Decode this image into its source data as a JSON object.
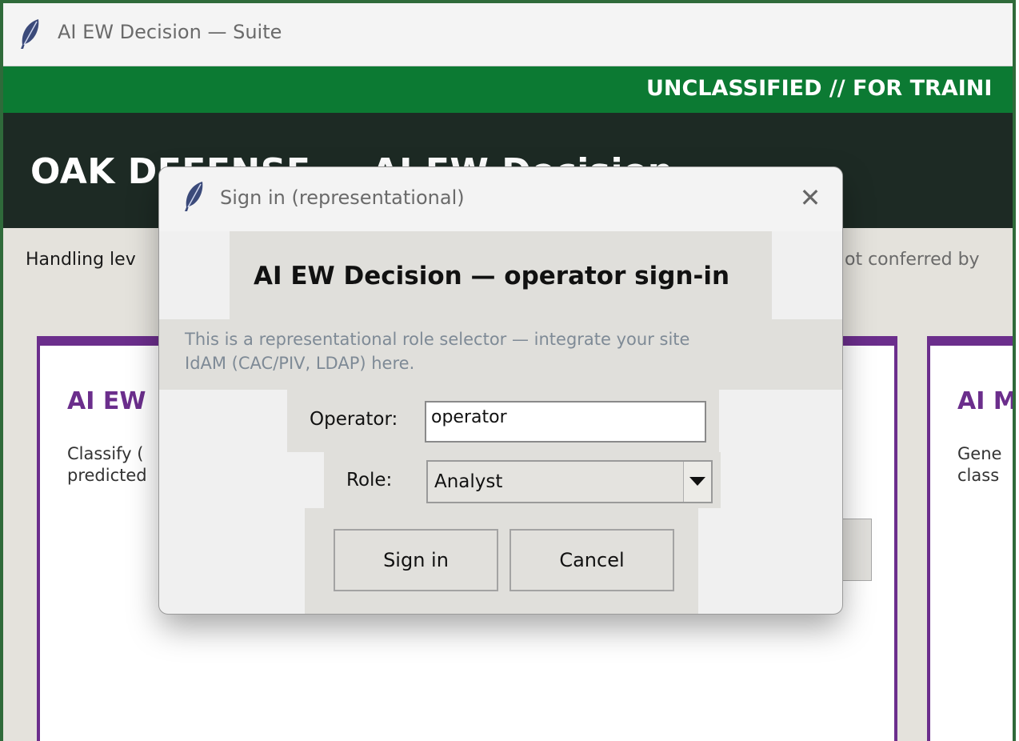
{
  "window": {
    "title": "AI EW Decision — Suite",
    "icon": "feather-icon"
  },
  "banner": {
    "text": "UNCLASSIFIED // FOR TRAINI"
  },
  "header": {
    "brand": "OAK DEFENSE — AI EW Decision"
  },
  "handling": {
    "text_left": "Handling lev",
    "text_right": "ot conferred by"
  },
  "cards": [
    {
      "title": "AI EW",
      "desc_line1": "Classify (",
      "desc_line2": "predicted"
    },
    {
      "title": "AI M",
      "desc_line1": "Gene",
      "desc_line2": "class"
    }
  ],
  "dialog": {
    "title": "Sign in (representational)",
    "close_glyph": "✕",
    "heading": "AI EW Decision — operator sign-in",
    "note_line1": "This is a representational role selector — integrate your site",
    "note_line2": "IdAM (CAC/PIV, LDAP) here.",
    "operator_label": "Operator:",
    "operator_value": "operator",
    "role_label": "Role:",
    "role_value": "Analyst",
    "signin_label": "Sign in",
    "cancel_label": "Cancel"
  },
  "colors": {
    "banner": "#0c7a33",
    "header": "#1d2a24",
    "card_accent": "#6b2e8c",
    "frame": "#2f6a3a"
  }
}
